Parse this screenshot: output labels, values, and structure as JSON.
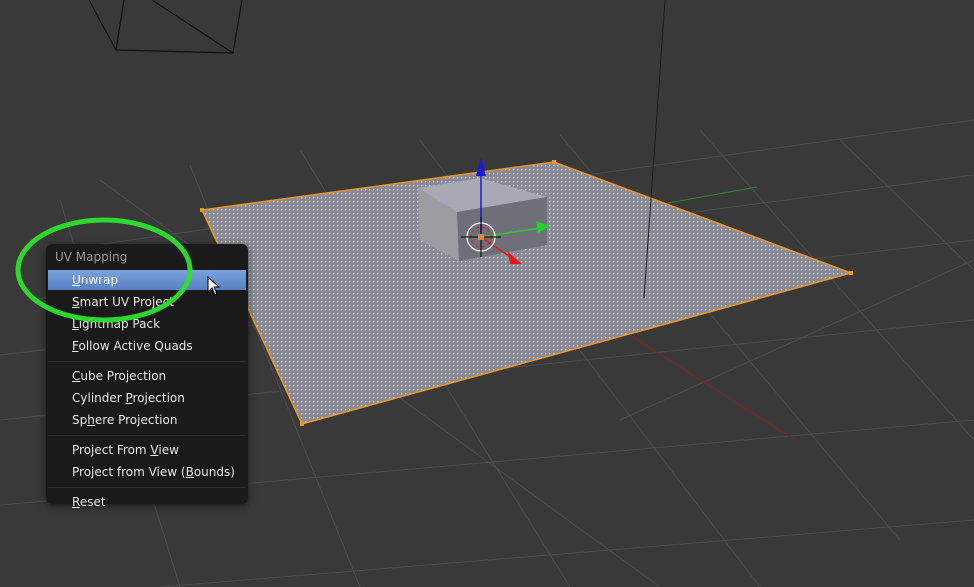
{
  "app": "Blender 3D Viewport",
  "colors": {
    "background": "#393939",
    "grid": "#4e4e4e",
    "selection_orange": "#f0961e",
    "x_axis": "#8c1e1e",
    "y_axis": "#2a8c2a",
    "gizmo_x": "#e01818",
    "gizmo_y": "#26d026",
    "gizmo_z": "#1a1ad8",
    "menu_bg": "#1a1a1a",
    "menu_highlight": "#6a92d4",
    "annotation_circle": "#2de02d"
  },
  "scene": {
    "objects": [
      {
        "name": "camera",
        "type": "camera-wireframe"
      },
      {
        "name": "plane",
        "type": "mesh",
        "selected": true,
        "mode": "edit"
      },
      {
        "name": "cube",
        "type": "mesh"
      },
      {
        "name": "lamp",
        "type": "light-line"
      }
    ],
    "gizmo": {
      "icon": "transform-manipulator-icon"
    },
    "cursor_3d": {
      "icon": "3d-cursor-icon"
    }
  },
  "menu": {
    "title": "UV Mapping",
    "groups": [
      [
        {
          "pre": "",
          "u": "U",
          "post": "nwrap",
          "active": true
        },
        {
          "pre": "",
          "u": "S",
          "post": "mart UV Project",
          "active": false
        },
        {
          "pre": "",
          "u": "L",
          "post": "ightmap Pack",
          "active": false
        },
        {
          "pre": "",
          "u": "F",
          "post": "ollow Active Quads",
          "active": false
        }
      ],
      [
        {
          "pre": "",
          "u": "C",
          "post": "ube Projection",
          "active": false
        },
        {
          "pre": "Cylinder ",
          "u": "P",
          "post": "rojection",
          "active": false
        },
        {
          "pre": "Sp",
          "u": "h",
          "post": "ere Projection",
          "active": false
        }
      ],
      [
        {
          "pre": "Project From ",
          "u": "V",
          "post": "iew",
          "active": false
        },
        {
          "pre": "Project from View (",
          "u": "B",
          "post": "ounds)",
          "active": false
        }
      ],
      [
        {
          "pre": "",
          "u": "R",
          "post": "eset",
          "active": false
        }
      ]
    ]
  },
  "annotation": {
    "shape": "ellipse",
    "target": "UV Mapping / Unwrap"
  },
  "mouse_cursor": {
    "icon": "arrow-pointer-icon"
  }
}
